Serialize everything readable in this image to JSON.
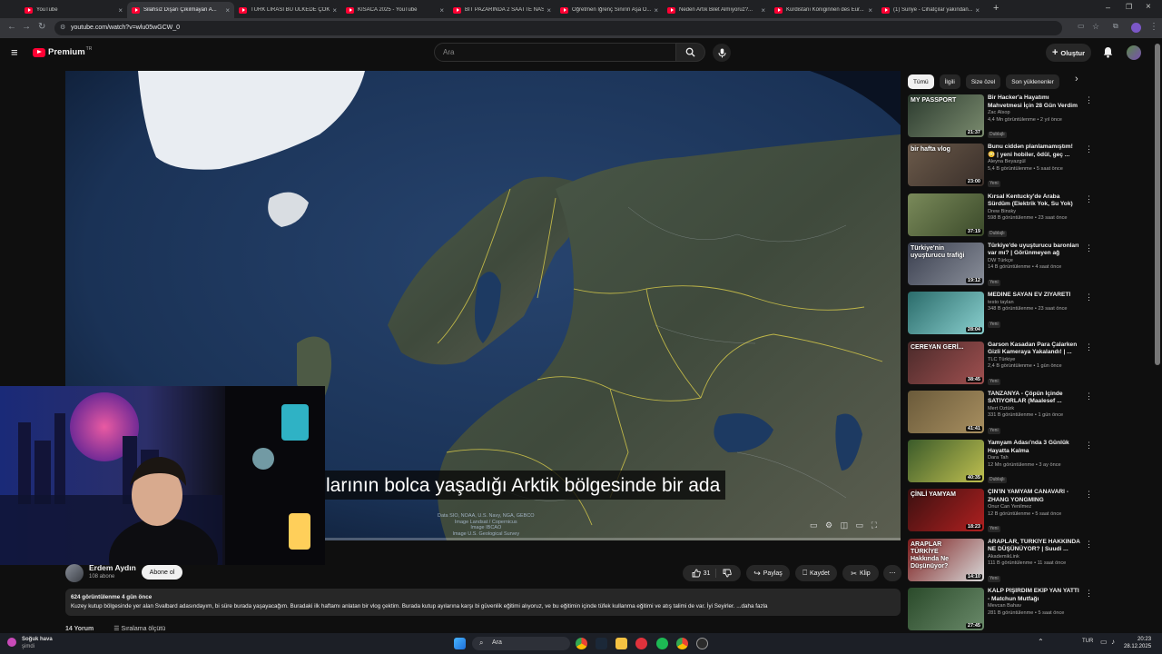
{
  "browser": {
    "tabs": [
      {
        "title": "YouTube"
      },
      {
        "title": "Silahsız Dışarı Çıkılmayan A..."
      },
      {
        "title": "TÜRK LİRASI BU ÜLKEDE ÇOK D..."
      },
      {
        "title": "KISACA 2025 - YouTube"
      },
      {
        "title": "BİT PAZARINDA 2 SAATTE NASI..."
      },
      {
        "title": "Öğretmen İğrenç Sınırın Aşa Ö..."
      },
      {
        "title": "Neden Artık Bilet Almıyoruz?..."
      },
      {
        "title": "Kürdistanı Königinnen des Eur..."
      },
      {
        "title": "(1) Suriye - Cihatçılar yakından..."
      }
    ],
    "url": "youtube.com/watch?v=wlu05wGCW_0"
  },
  "header": {
    "logo_text": "Premium",
    "logo_sup": "TR",
    "search_placeholder": "Ara",
    "create_label": "Oluştur"
  },
  "player": {
    "caption": "larının bolca yaşadığı Arktik bölgesinde bir ada",
    "attribution_1": "Data SIO, NOAA, U.S. Navy, NGA, GEBCO",
    "attribution_2": "Image Landsat / Copernicus",
    "attribution_3": "Image IBCAO",
    "attribution_4": "Image U.S. Geological Survey"
  },
  "channel": {
    "name": "Erdem Aydın",
    "subs": "108 abone",
    "subscribe_label": "Abone ol",
    "likes": "31",
    "share_label": "Paylaş",
    "save_label": "Kaydet",
    "clip_label": "Klip"
  },
  "description": {
    "meta": "624 görüntülenme  4 gün önce",
    "text": "Kuzey kutup bölgesinde yer alan Svalbard adasındayım, bi süre burada yaşayacağım. Buradaki ilk haftamı anlatan bir vlog çektim. Burada kutup ayılarına karşı bi güvenlik eğitimi alıyoruz, ve bu eğitimin içinde tüfek kullanma eğitimi ve atış talimi de var. İyi Seyirler. ...daha fazla"
  },
  "below": {
    "comments": "14 Yorum",
    "sort_label": "Sıralama ölçütü"
  },
  "sidebar": {
    "chips": [
      "Tümü",
      "İlgili",
      "Size özel",
      "Son yüklenenler"
    ],
    "videos": [
      {
        "title": "Bir Hacker'a Hayatımı Mahvetmesi İçin 28 Gün Verdim",
        "channel": "Zac Alsop",
        "meta": "4,4 Mn görüntülenme • 2 yıl önce",
        "badge": "Dublajlı",
        "duration": "21:37",
        "thumb_text": "MY PASSPORT"
      },
      {
        "title": "Bunu ciddən planlamamıştım! 😳 | yeni hobiler, ödül, geç ...",
        "channel": "Aleyna Beyazgül",
        "meta": "5,4 B görüntülenme • 5 saat önce",
        "badge": "Yeni",
        "duration": "23:00",
        "thumb_text": "bir hafta vlog"
      },
      {
        "title": "Kırsal Kentucky'de Araba Sürdüm (Elektrik Yok, Su Yok)",
        "channel": "Drew Binsky",
        "meta": "598 B görüntülenme • 23 saat önce",
        "badge": "Dublajlı",
        "duration": "37:19",
        "thumb_text": ""
      },
      {
        "title": "Türkiye'de uyuşturucu baronları var mı? | Görünmeyen ağ",
        "channel": "DW Türkçe",
        "meta": "14 B görüntülenme • 4 saat önce",
        "badge": "Yeni",
        "duration": "19:12",
        "thumb_text": "Türkiye'nin uyuşturucu trafiği"
      },
      {
        "title": "MEDİNE SAYAN EV ZİYARETİ",
        "channel": "testo taylan",
        "meta": "348 B görüntülenme • 23 saat önce",
        "badge": "Yeni",
        "duration": "28:04",
        "thumb_text": ""
      },
      {
        "title": "Garson Kasadan Para Çalarken Gizli Kameraya Yakalandı! | ...",
        "channel": "TLC Türkiye",
        "meta": "2,4 B görüntülenme • 1 gün önce",
        "badge": "Yeni",
        "duration": "38:45",
        "thumb_text": "CEREYAN GERİ..."
      },
      {
        "title": "TANZANYA - Çöpün İçinde SATIYORLAR (Maalesef ...",
        "channel": "Mert Öztürk",
        "meta": "331 B görüntülenme • 1 gün önce",
        "badge": "Yeni",
        "duration": "41:41",
        "thumb_text": ""
      },
      {
        "title": "Yamyam Adası'nda 3 Günlük Hayatta Kalma",
        "channel": "Dara Tah",
        "meta": "12 Mn görüntülenme • 3 ay önce",
        "badge": "Dublajlı",
        "duration": "40:35",
        "thumb_text": ""
      },
      {
        "title": "ÇİN'İN YAMYAM CANAVARI - ZHANG YONGMING",
        "channel": "Onur Can Yenilmez",
        "meta": "12 B görüntülenme • 5 saat önce",
        "badge": "Yeni",
        "duration": "18:23",
        "thumb_text": "ÇİNLİ YAMYAM"
      },
      {
        "title": "ARAPLAR, TÜRKİYE HAKKINDA NE DÜŞÜNÜYOR? | Suudi ...",
        "channel": "AkademikLink",
        "meta": "111 B görüntülenme • 11 saat önce",
        "badge": "Yeni",
        "duration": "14:10",
        "thumb_text": "ARAPLAR TÜRKİYE Hakkında Ne Düşünüyor?"
      },
      {
        "title": "KALP PİŞİRDİM EKİP YAN YATTI - Matchun Mutfağı",
        "channel": "Mevcan Bahav",
        "meta": "281 B görüntülenme • 5 saat önce",
        "badge": "",
        "duration": "27:45",
        "thumb_text": ""
      }
    ]
  },
  "taskbar": {
    "weather_title": "Soğuk hava",
    "weather_sub": "şimdi",
    "search_label": "Ara",
    "lang": "TUR",
    "time": "20:23",
    "date": "28.12.2025"
  },
  "colors": {
    "youtube_red": "#ff0033",
    "background": "#0f0f0f",
    "chip_bg": "#272727"
  }
}
